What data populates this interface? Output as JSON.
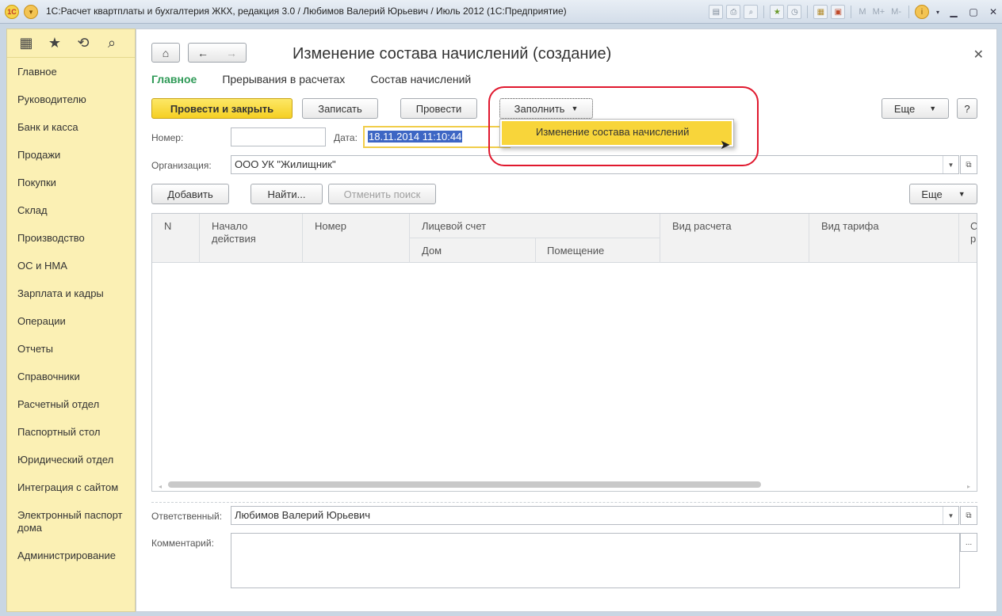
{
  "window": {
    "title": "1С:Расчет квартплаты и бухгалтерия ЖКХ, редакция 3.0 / Любимов Валерий Юрьевич / Июль 2012  (1С:Предприятие)",
    "logo_text": "1С",
    "toolbar_m": "M",
    "toolbar_mplus": "M+",
    "toolbar_mminus": "M-"
  },
  "sidebar": {
    "items": [
      {
        "label": "Главное"
      },
      {
        "label": "Руководителю"
      },
      {
        "label": "Банк и касса"
      },
      {
        "label": "Продажи"
      },
      {
        "label": "Покупки"
      },
      {
        "label": "Склад"
      },
      {
        "label": "Производство"
      },
      {
        "label": "ОС и НМА"
      },
      {
        "label": "Зарплата и кадры"
      },
      {
        "label": "Операции"
      },
      {
        "label": "Отчеты"
      },
      {
        "label": "Справочники"
      },
      {
        "label": "Расчетный отдел"
      },
      {
        "label": "Паспортный стол"
      },
      {
        "label": "Юридический отдел"
      },
      {
        "label": "Интеграция с сайтом"
      },
      {
        "label": "Электронный паспорт дома"
      },
      {
        "label": "Администрирование"
      }
    ]
  },
  "form": {
    "title": "Изменение состава начислений (создание)",
    "tabs": [
      {
        "label": "Главное"
      },
      {
        "label": "Прерывания в расчетах"
      },
      {
        "label": "Состав начислений"
      }
    ],
    "buttons": {
      "post_close": "Провести и закрыть",
      "save": "Записать",
      "post": "Провести",
      "fill": "Заполнить",
      "more": "Еще",
      "help": "?"
    },
    "fill_menu": {
      "item": "Изменение состава начислений"
    },
    "number": {
      "label": "Номер:",
      "value": ""
    },
    "date": {
      "label": "Дата:",
      "value": "18.11.2014 11:10:44"
    },
    "organization": {
      "label": "Организация:",
      "value": "ООО УК \"Жилищник\""
    },
    "table_toolbar": {
      "add": "Добавить",
      "find": "Найти...",
      "cancel_search": "Отменить поиск",
      "more": "Еще"
    },
    "table": {
      "col_n": "N",
      "col_start": "Начало действия",
      "col_number": "Номер",
      "col_account": "Лицевой счет",
      "col_house": "Дом",
      "col_room": "Помещение",
      "col_calc_type": "Вид расчета",
      "col_tariff_type": "Вид тарифа",
      "col_partial": "С\nр"
    },
    "responsible": {
      "label": "Ответственный:",
      "value": "Любимов Валерий Юрьевич"
    },
    "comment": {
      "label": "Комментарий:",
      "value": "",
      "button": "..."
    }
  }
}
